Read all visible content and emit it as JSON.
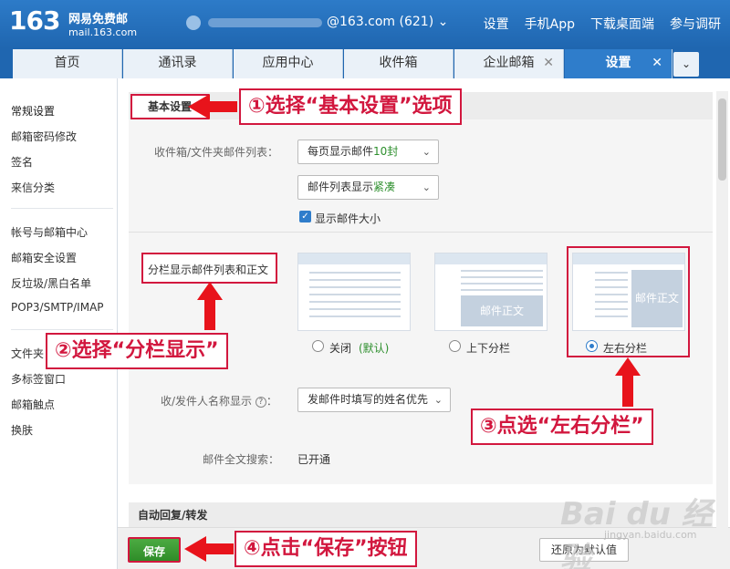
{
  "header": {
    "logo_num": "163",
    "logo_cn": "网易免费邮",
    "logo_url": "mail.163.com",
    "account": "@163.com (621) ⌄",
    "links": [
      "设置",
      "手机App",
      "下载桌面端",
      "参与调研"
    ]
  },
  "tabs": [
    {
      "label": "首页",
      "closable": false
    },
    {
      "label": "通讯录",
      "closable": false
    },
    {
      "label": "应用中心",
      "closable": false
    },
    {
      "label": "收件箱",
      "closable": false
    },
    {
      "label": "企业邮箱",
      "closable": true
    },
    {
      "label": "设置",
      "closable": true,
      "active": true
    }
  ],
  "tab_more": "⌄",
  "sidebar": {
    "group1": [
      "常规设置",
      "邮箱密码修改",
      "签名",
      "来信分类"
    ],
    "group2": [
      "帐号与邮箱中心",
      "邮箱安全设置",
      "反垃圾/黑白名单",
      "POP3/SMTP/IMAP"
    ],
    "group3": [
      "文件夹",
      "多标签窗口",
      "邮箱触点",
      "换肤"
    ]
  },
  "settings": {
    "basic_title": "基本设置",
    "mail_list_label": "收件箱/文件夹邮件列表：",
    "per_page_prefix": "每页显示邮件",
    "per_page_value": "10封",
    "density_prefix": "邮件列表显示",
    "density_value": "紧凑",
    "show_size_label": "显示邮件大小",
    "split_label": "分栏显示邮件列表和正文",
    "thumb_body_label": "邮件正文",
    "option_off": "关闭",
    "option_off_default": "(默认)",
    "option_topbottom": "上下分栏",
    "option_leftright": "左右分栏",
    "sender_name_label": "收/发件人名称显示",
    "sender_name_value": "发邮件时填写的姓名优先",
    "fulltext_label": "邮件全文搜索：",
    "fulltext_value": "已开通",
    "auto_reply_title": "自动回复/转发"
  },
  "footer": {
    "save_label": "保存",
    "reset_label": "还原为默认值"
  },
  "callouts": {
    "step1": "①选择“基本设置”选项",
    "step2": "②选择“分栏显示”",
    "step3": "③点选“左右分栏”",
    "step4": "④点击“保存”按钮"
  },
  "watermark": {
    "main": "Bai du 经验",
    "sub": "jingyan.baidu.com"
  }
}
